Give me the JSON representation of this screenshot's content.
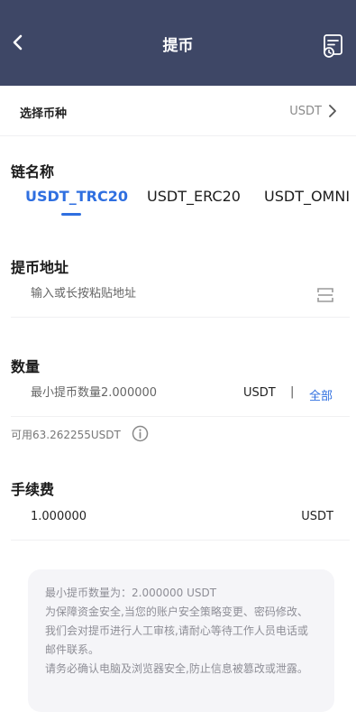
{
  "header": {
    "title": "提币",
    "back_icon": "chevron-left-icon",
    "record_icon": "withdraw-record-icon",
    "background": "#3e4766"
  },
  "coin_row": {
    "label": "选择币种",
    "value": "USDT"
  },
  "chain": {
    "title": "链名称",
    "tabs": [
      "USDT_TRC20",
      "USDT_ERC20",
      "USDT_OMNI"
    ],
    "active_tab": "USDT_TRC20",
    "accent": "#2f6fe0"
  },
  "address": {
    "title": "提币地址",
    "placeholder": "输入或长按粘贴地址",
    "value": ""
  },
  "quantity": {
    "title": "数量",
    "placeholder": "最小提币数量2.000000",
    "unit": "USDT",
    "separator": "|",
    "all_label": "全部",
    "available": "可用63.262255USDT"
  },
  "fee": {
    "title": "手续费",
    "value": "1.000000",
    "unit": "USDT"
  },
  "notice": {
    "lines": [
      "最小提币数量为：2.000000 USDT",
      "为保障资金安全,当您的账户安全策略变更、密码修改、我们会对提币进行人工审核,请耐心等待工作人员电话或邮件联系。",
      "请务必确认电脑及浏览器安全,防止信息被篡改或泄露。"
    ]
  }
}
